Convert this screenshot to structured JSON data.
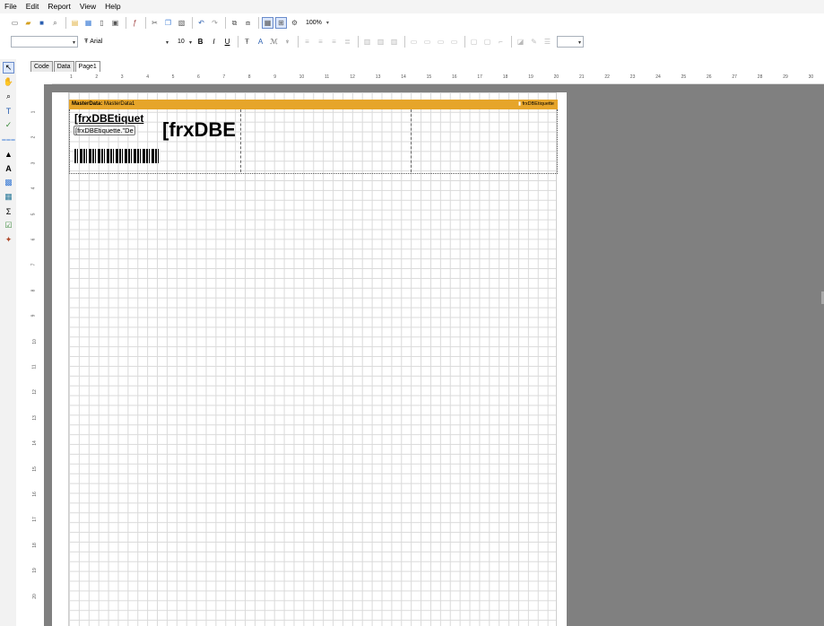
{
  "menubar": {
    "items": [
      "File",
      "Edit",
      "Report",
      "View",
      "Help"
    ]
  },
  "toolbar": {
    "zoom_value": "100%",
    "font_name": "Arial",
    "font_size": "10"
  },
  "tabs": [
    "Code",
    "Data",
    "Page1"
  ],
  "active_tab": "Page1",
  "ruler": {
    "h_marks": [
      "1",
      "2",
      "3",
      "4",
      "5",
      "6",
      "7",
      "8",
      "9",
      "10",
      "11",
      "12",
      "13",
      "14",
      "15",
      "16",
      "17",
      "18",
      "19",
      "20",
      "21",
      "22",
      "23",
      "24",
      "25",
      "26",
      "27",
      "28",
      "29",
      "30"
    ],
    "v_marks": [
      "1",
      "2",
      "3",
      "4",
      "5",
      "6",
      "7",
      "8",
      "9",
      "10",
      "11",
      "12",
      "13",
      "14",
      "15",
      "16",
      "17",
      "18",
      "19",
      "20"
    ]
  },
  "band": {
    "type_label": "MasterData:",
    "name": "MasterData1",
    "dataset": "frxDBEtiquette"
  },
  "objects": {
    "label1": "[frxDBEtiquet",
    "label2": "[frxDBEtiquette.\"De",
    "label3": "[frxDBE"
  },
  "colors": {
    "band_header": "#e6a52a",
    "workspace": "#808080"
  }
}
